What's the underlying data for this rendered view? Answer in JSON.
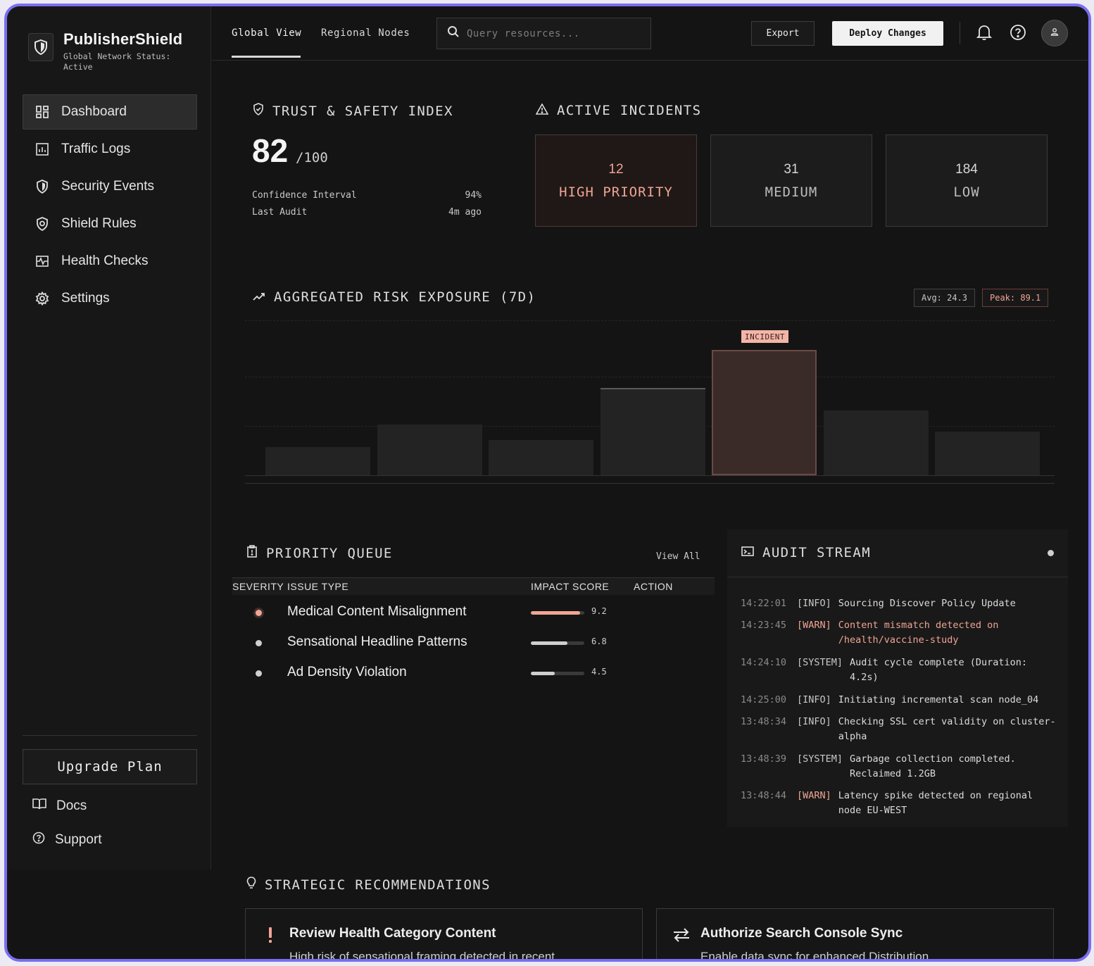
{
  "brand": {
    "name": "PublisherShield",
    "status": "Global Network Status: Active"
  },
  "sidebar": {
    "items": [
      {
        "label": "Dashboard",
        "icon": "dashboard-icon",
        "active": true
      },
      {
        "label": "Traffic Logs",
        "icon": "chart-icon"
      },
      {
        "label": "Security Events",
        "icon": "shield-icon"
      },
      {
        "label": "Shield Rules",
        "icon": "shield-rules-icon"
      },
      {
        "label": "Health Checks",
        "icon": "pulse-icon"
      },
      {
        "label": "Settings",
        "icon": "gear-icon"
      }
    ],
    "upgrade_label": "Upgrade Plan",
    "docs_label": "Docs",
    "support_label": "Support"
  },
  "topbar": {
    "tabs": [
      {
        "label": "Global View",
        "active": true
      },
      {
        "label": "Regional Nodes"
      }
    ],
    "search_placeholder": "Query resources...",
    "export_label": "Export",
    "deploy_label": "Deploy Changes"
  },
  "trust": {
    "title": "TRUST & SAFETY INDEX",
    "score": "82",
    "score_of": "/100",
    "confidence_label": "Confidence Interval",
    "confidence_value": "94%",
    "audit_label": "Last Audit",
    "audit_value": "4m ago"
  },
  "incidents": {
    "title": "ACTIVE INCIDENTS",
    "cards": [
      {
        "count": "12",
        "label": "HIGH PRIORITY"
      },
      {
        "count": "31",
        "label": "MEDIUM"
      },
      {
        "count": "184",
        "label": "LOW"
      }
    ]
  },
  "risk": {
    "title": "AGGREGATED RISK EXPOSURE (7D)",
    "avg": "Avg: 24.3",
    "peak": "Peak: 89.1",
    "incident_tag": "INCIDENT"
  },
  "chart_data": {
    "type": "bar",
    "title": "AGGREGATED RISK EXPOSURE (7D)",
    "values": [
      20,
      36,
      25,
      62,
      89.1,
      46,
      31
    ],
    "ylim": [
      0,
      100
    ],
    "highlight_index": 4,
    "highlight_label": "INCIDENT",
    "grid": true
  },
  "queue": {
    "title": "PRIORITY QUEUE",
    "view_all": "View All",
    "headers": {
      "severity": "SEVERITY",
      "issue": "ISSUE TYPE",
      "impact": "IMPACT SCORE",
      "action": "ACTION"
    },
    "rows": [
      {
        "issue": "Medical Content Misalignment",
        "score": "9.2",
        "fraction": 0.92,
        "hot": true
      },
      {
        "issue": "Sensational Headline Patterns",
        "score": "6.8",
        "fraction": 0.68,
        "hot": false
      },
      {
        "issue": "Ad Density Violation",
        "score": "4.5",
        "fraction": 0.45,
        "hot": false
      }
    ]
  },
  "audit": {
    "title": "AUDIT STREAM",
    "logs": [
      {
        "time": "14:22:01",
        "level": "[INFO]",
        "msg": "Sourcing Discover Policy Update",
        "kind": "info"
      },
      {
        "time": "14:23:45",
        "level": "[WARN]",
        "msg": "Content mismatch detected on /health/vaccine-study",
        "kind": "warn"
      },
      {
        "time": "14:24:10",
        "level": "[SYSTEM]",
        "msg": "Audit cycle complete (Duration: 4.2s)",
        "kind": "system"
      },
      {
        "time": "14:25:00",
        "level": "[INFO]",
        "msg": "Initiating incremental scan node_04",
        "kind": "info"
      },
      {
        "time": "13:48:34",
        "level": "[INFO]",
        "msg": "Checking SSL cert validity on cluster-alpha",
        "kind": "info"
      },
      {
        "time": "13:48:39",
        "level": "[SYSTEM]",
        "msg": "Garbage collection completed. Reclaimed 1.2GB",
        "kind": "system"
      },
      {
        "time": "13:48:44",
        "level": "[WARN]",
        "msg": "Latency spike detected on regional node EU-WEST",
        "kind": "warn2"
      }
    ]
  },
  "recommendations": {
    "title": "STRATEGIC RECOMMENDATIONS",
    "cards": [
      {
        "title": "Review Health Category Content",
        "desc": "High risk of sensational framing detected in recent",
        "icon": "alert-icon"
      },
      {
        "title": "Authorize Search Console Sync",
        "desc": "Enable data sync for enhanced Distribution",
        "icon": "sync-icon"
      }
    ]
  },
  "colors": {
    "accent": "#f3a493",
    "frame": "#7a6ff0",
    "background": "#141414"
  }
}
